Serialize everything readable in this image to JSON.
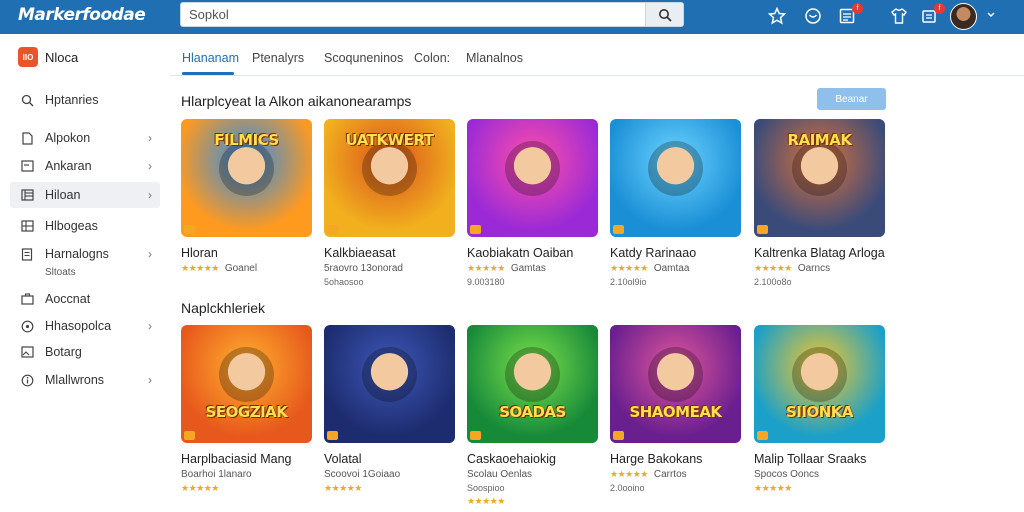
{
  "header": {
    "logo": "Markerfoodae",
    "search_placeholder": "Sopkol",
    "notification_badges": [
      "f",
      "f"
    ]
  },
  "leftnav": {
    "brand_tile": "IIO",
    "brand_name": "Nloca"
  },
  "tabs": [
    "Hlananam",
    "Ptenalyrs",
    "Scoquneninos",
    "Colon:",
    "Mlanalnos"
  ],
  "sidebar": {
    "items": [
      {
        "label": "Hptanries",
        "has_chevron": false,
        "icon": "search-icon"
      },
      {
        "label": "Alpokon",
        "has_chevron": true,
        "icon": "document-icon"
      },
      {
        "label": "Ankaran",
        "has_chevron": true,
        "icon": "window-icon"
      },
      {
        "label": "Hiloan",
        "has_chevron": true,
        "icon": "calendar-icon",
        "active": true
      },
      {
        "label": "Hlbogeas",
        "has_chevron": false,
        "icon": "grid-icon"
      },
      {
        "label": "Harnalogns",
        "has_chevron": true,
        "icon": "doc-lines-icon",
        "sub": "Sltoats"
      },
      {
        "label": "Aoccnat",
        "has_chevron": false,
        "icon": "briefcase-icon"
      },
      {
        "label": "Hhasopolca",
        "has_chevron": true,
        "icon": "globe-icon"
      },
      {
        "label": "Botarg",
        "has_chevron": false,
        "icon": "image-icon"
      },
      {
        "label": "Mlallwrons",
        "has_chevron": true,
        "icon": "info-icon"
      }
    ]
  },
  "sections": [
    {
      "title": "Hlarplcyeat la Alkon aikanonearamps",
      "button": "Beanar",
      "cards": [
        {
          "title_art": "FILMICS",
          "name": "Hloran",
          "meta": "Goanel",
          "stars_first": true,
          "count": "",
          "colors": [
            "#ff9a1f",
            "#2f8be6"
          ]
        },
        {
          "title_art": "UATKWERT",
          "name": "Kalkbiaeasat",
          "meta": "5raovro 13onorad",
          "stars_first": false,
          "count": "5ohaosoo",
          "colors": [
            "#f2b01e",
            "#d9531e"
          ]
        },
        {
          "title_art": "",
          "name": "Kaobiakatn Oaiban",
          "meta": "Gamtas",
          "stars_first": true,
          "count": "9.003180",
          "colors": [
            "#9b2ad6",
            "#ff4fa8"
          ]
        },
        {
          "title_art": "",
          "name": "Katdy Rarinaao",
          "meta": "Oamtaa",
          "stars_first": true,
          "count": "2.10ol9io",
          "colors": [
            "#1a8fd6",
            "#6cd3ff"
          ]
        },
        {
          "title_art": "RAIMAK",
          "name": "Kaltrenka Blatag Arloga",
          "meta": "Oarncs",
          "stars_first": true,
          "count": "2.100o8o",
          "colors": [
            "#3a4b7a",
            "#d9713a"
          ]
        }
      ]
    },
    {
      "title": "Naplckhleriek",
      "button": "",
      "cards": [
        {
          "title_art": "SEOGZIAK",
          "name": "Harplbaciasid Mang",
          "meta": "Boarhoi 1lanaro",
          "stars_first": false,
          "count": "",
          "colors": [
            "#e7581c",
            "#ffb02e"
          ]
        },
        {
          "title_art": "",
          "name": "Volatal",
          "meta": "Scoovoi 1Goiaao",
          "stars_first": false,
          "count": "",
          "colors": [
            "#1d2c6e",
            "#3d57b8"
          ]
        },
        {
          "title_art": "SOADAS",
          "name": "Caskaoehaiokig",
          "meta": "Scolau Oenlas",
          "stars_first": false,
          "count": "Soospioo",
          "colors": [
            "#178a3a",
            "#7be04a"
          ]
        },
        {
          "title_art": "SHAOMEAK",
          "name": "Harge Bakokans",
          "meta": "Carrtos",
          "stars_first": true,
          "count": "2.0ooino",
          "colors": [
            "#6a1f8f",
            "#e0559c"
          ]
        },
        {
          "title_art": "SIIONKA",
          "name": "Malip Tollaar Sraaks",
          "meta": "Spocos Ooncs",
          "stars_first": false,
          "count": "",
          "colors": [
            "#1aa0c9",
            "#f7c62a"
          ]
        }
      ]
    }
  ],
  "stars": "★★★★★"
}
